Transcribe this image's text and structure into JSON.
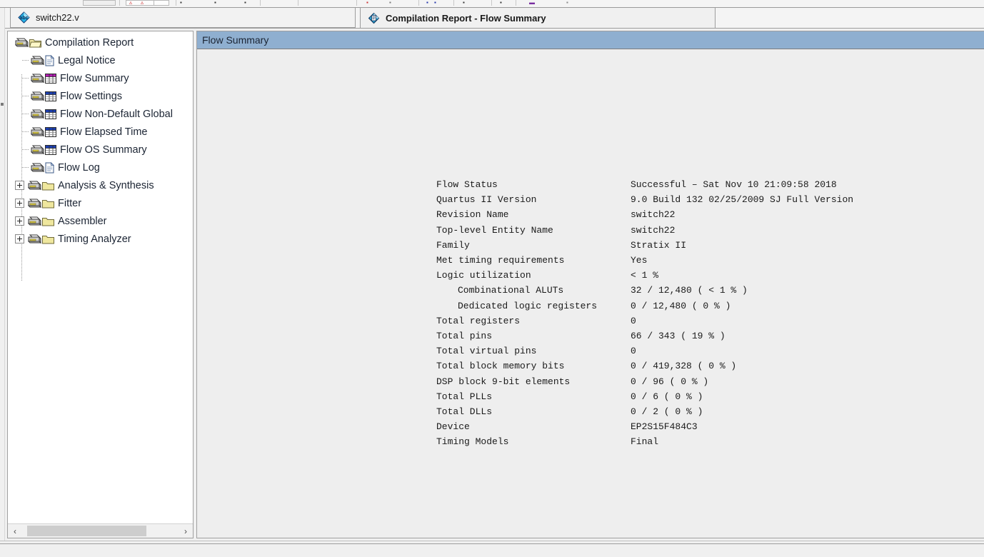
{
  "toolbar": {
    "note": "partially cropped toolbar row at top of window",
    "separators_count": 10
  },
  "tabs": [
    {
      "label": "switch22.v",
      "icon": "abc-diamond-icon",
      "active": false
    },
    {
      "label": "Compilation Report - Flow Summary",
      "icon": "report-diamond-icon",
      "active": true
    }
  ],
  "tree": {
    "root_label": "Compilation Report",
    "items": [
      {
        "label": "Compilation Report",
        "depth": 0,
        "icon": "folder-icon",
        "expander": "none",
        "selected": false
      },
      {
        "label": "Legal Notice",
        "depth": 1,
        "icon": "page-icon",
        "expander": "none",
        "selected": false
      },
      {
        "label": "Flow Summary",
        "depth": 1,
        "icon": "table-magenta-icon",
        "expander": "none",
        "selected": true
      },
      {
        "label": "Flow Settings",
        "depth": 1,
        "icon": "table-blue-icon",
        "expander": "none",
        "selected": false
      },
      {
        "label": "Flow Non-Default Global",
        "depth": 1,
        "icon": "table-blue-icon",
        "expander": "none",
        "selected": false
      },
      {
        "label": "Flow Elapsed Time",
        "depth": 1,
        "icon": "table-blue-icon",
        "expander": "none",
        "selected": false
      },
      {
        "label": "Flow OS Summary",
        "depth": 1,
        "icon": "table-blue-icon",
        "expander": "none",
        "selected": false
      },
      {
        "label": "Flow Log",
        "depth": 1,
        "icon": "page-icon",
        "expander": "none",
        "selected": false
      },
      {
        "label": "Analysis & Synthesis",
        "depth": 1,
        "icon": "folder-icon",
        "expander": "plus",
        "selected": false
      },
      {
        "label": "Fitter",
        "depth": 1,
        "icon": "folder-icon",
        "expander": "plus",
        "selected": false
      },
      {
        "label": "Assembler",
        "depth": 1,
        "icon": "folder-icon",
        "expander": "plus",
        "selected": false
      },
      {
        "label": "Timing Analyzer",
        "depth": 1,
        "icon": "folder-icon",
        "expander": "plus",
        "selected": false
      }
    ],
    "scrollbar": {
      "left_arrow": "‹",
      "right_arrow": "›"
    }
  },
  "report": {
    "header_title": "Flow Summary",
    "header_color": "#8fafd0",
    "rows": [
      {
        "key": "Flow Status",
        "value": "Successful – Sat Nov 10 21:09:58 2018",
        "indent": false
      },
      {
        "key": "Quartus II Version",
        "value": "9.0 Build 132 02/25/2009 SJ Full Version",
        "indent": false
      },
      {
        "key": "Revision Name",
        "value": "switch22",
        "indent": false
      },
      {
        "key": "Top-level Entity Name",
        "value": "switch22",
        "indent": false
      },
      {
        "key": "Family",
        "value": "Stratix II",
        "indent": false
      },
      {
        "key": "Met timing requirements",
        "value": "Yes",
        "indent": false
      },
      {
        "key": "Logic utilization",
        "value": "< 1 %",
        "indent": false
      },
      {
        "key": "Combinational ALUTs",
        "value": "32 / 12,480 ( < 1 % )",
        "indent": true
      },
      {
        "key": "Dedicated logic registers",
        "value": "0 / 12,480 ( 0 % )",
        "indent": true
      },
      {
        "key": "Total registers",
        "value": "0",
        "indent": false
      },
      {
        "key": "Total pins",
        "value": "66 / 343 ( 19 % )",
        "indent": false
      },
      {
        "key": "Total virtual pins",
        "value": "0",
        "indent": false
      },
      {
        "key": "Total block memory bits",
        "value": "0 / 419,328 ( 0 % )",
        "indent": false
      },
      {
        "key": "DSP block 9-bit elements",
        "value": "0 / 96 ( 0 % )",
        "indent": false
      },
      {
        "key": "Total PLLs",
        "value": "0 / 6 ( 0 % )",
        "indent": false
      },
      {
        "key": "Total DLLs",
        "value": "0 / 2 ( 0 % )",
        "indent": false
      },
      {
        "key": "Device",
        "value": "EP2S15F484C3",
        "indent": false
      },
      {
        "key": "Timing Models",
        "value": "Final",
        "indent": false
      }
    ]
  },
  "colors": {
    "header_blue": "#8fafd0",
    "panel_gray": "#eeeeee",
    "window_gray": "#f0f0f0",
    "tree_text": "#1b2433",
    "folder_yellow": "#f0e68c",
    "table_header_magenta": "#b21cb2",
    "table_header_blue": "#1c3fb2"
  }
}
